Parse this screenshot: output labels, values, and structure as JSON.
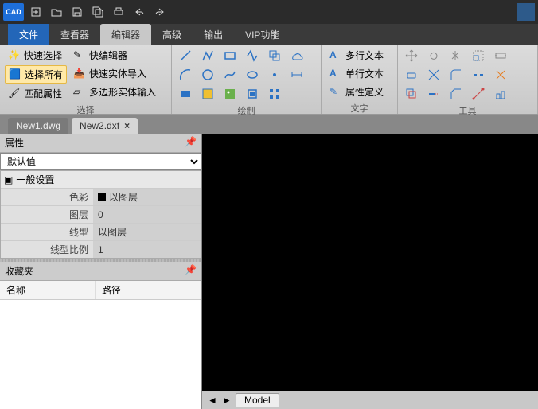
{
  "app": {
    "logo": "CAD"
  },
  "menu": {
    "file": "文件",
    "viewer": "查看器",
    "editor": "编辑器",
    "advanced": "高级",
    "output": "输出",
    "vip": "VIP功能"
  },
  "ribbon": {
    "select": {
      "label": "选择",
      "quick_select": "快速选择",
      "select_all": "选择所有",
      "match_prop": "匹配属性",
      "quick_editor": "快编辑器",
      "quick_entity_import": "快速实体导入",
      "polygon_entity_input": "多边形实体输入"
    },
    "draw_label": "绘制",
    "text": {
      "label": "文字",
      "multiline": "多行文本",
      "singleline": "单行文本",
      "attrdef": "属性定义"
    },
    "tools_label": "工具"
  },
  "tabs": {
    "items": [
      {
        "label": "New1.dwg",
        "active": false
      },
      {
        "label": "New2.dxf",
        "active": true
      }
    ]
  },
  "properties": {
    "title": "属性",
    "combo_value": "默认值",
    "section": "一般设置",
    "rows": {
      "color_key": "色彩",
      "color_val": "以图层",
      "layer_key": "图层",
      "layer_val": "0",
      "ltype_key": "线型",
      "ltype_val": "以图层",
      "ltscale_key": "线型比例",
      "ltscale_val": "1"
    }
  },
  "favorites": {
    "title": "收藏夹",
    "col_name": "名称",
    "col_path": "路径"
  },
  "model_tab": "Model"
}
